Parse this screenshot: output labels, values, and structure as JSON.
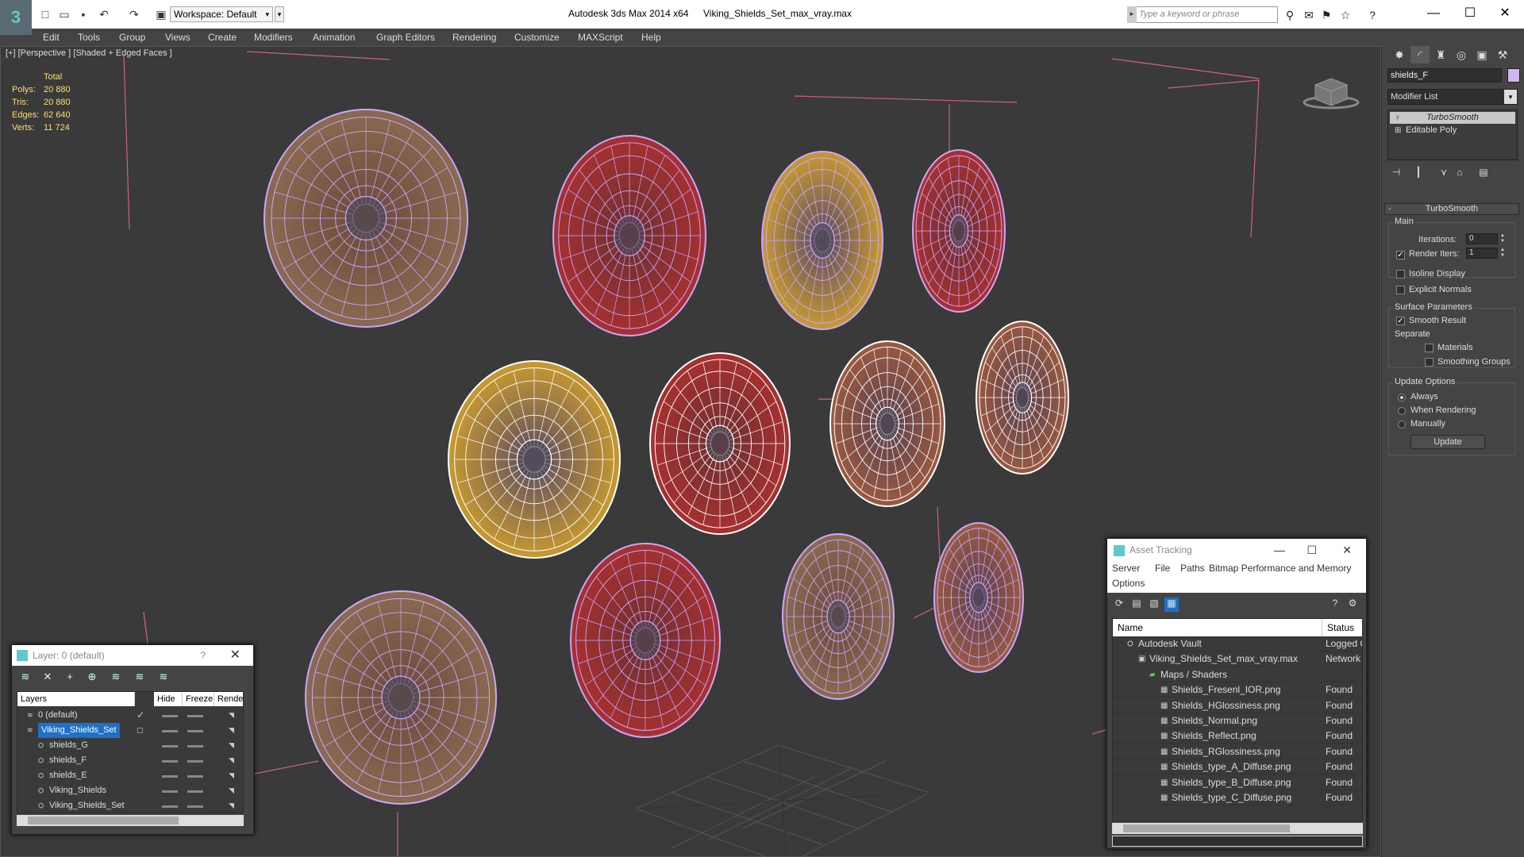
{
  "titlebar": {
    "workspace": "Workspace: Default",
    "app_title": "Autodesk 3ds Max  2014 x64",
    "file_title": "Viking_Shields_Set_max_vray.max",
    "search_placeholder": "Type a keyword or phrase"
  },
  "menu": [
    "Edit",
    "Tools",
    "Group",
    "Views",
    "Create",
    "Modifiers",
    "Animation",
    "Graph Editors",
    "Rendering",
    "Customize",
    "MAXScript",
    "Help"
  ],
  "viewport": {
    "label": "[+] [Perspective ] [Shaded + Edged Faces ]",
    "stats": {
      "header": "Total",
      "rows": [
        {
          "k": "Polys:",
          "v": "20 880"
        },
        {
          "k": "Tris:",
          "v": "20 880"
        },
        {
          "k": "Edges:",
          "v": "62 640"
        },
        {
          "k": "Verts:",
          "v": "11 724"
        }
      ]
    },
    "wire_color": "#c9a6ff",
    "selected_wire_color": "#ffffff"
  },
  "command_panel": {
    "object_name": "shields_F",
    "object_color": "#d2b4f0",
    "modifier_list": "Modifier List",
    "stack": [
      "TurboSmooth",
      "Editable Poly"
    ],
    "rollout": "TurboSmooth",
    "main_group": "Main",
    "iterations_label": "Iterations:",
    "iterations_value": "0",
    "render_iters_label": "Render Iters:",
    "render_iters_value": "1",
    "isoline_label": "Isoline Display",
    "explicit_normals_label": "Explicit Normals",
    "surface_group": "Surface Parameters",
    "smooth_result_label": "Smooth Result",
    "separate_label": "Separate",
    "materials_label": "Materials",
    "smoothing_groups_label": "Smoothing Groups",
    "update_group": "Update Options",
    "always_label": "Always",
    "when_rendering_label": "When Rendering",
    "manually_label": "Manually",
    "update_button": "Update"
  },
  "layer_dialog": {
    "title": "Layer: 0 (default)",
    "help": "?",
    "columns": [
      "Layers",
      "Hide",
      "Freeze",
      "Rende"
    ],
    "rows": [
      {
        "name": "0 (default)",
        "indent": 0,
        "selected": false
      },
      {
        "name": "Viking_Shields_Set",
        "indent": 0,
        "selected": true
      },
      {
        "name": "shields_G",
        "indent": 1,
        "selected": false
      },
      {
        "name": "shields_F",
        "indent": 1,
        "selected": false
      },
      {
        "name": "shields_E",
        "indent": 1,
        "selected": false
      },
      {
        "name": "Viking_Shields",
        "indent": 1,
        "selected": false
      },
      {
        "name": "Viking_Shields_Set",
        "indent": 1,
        "selected": false
      }
    ]
  },
  "asset_dialog": {
    "title": "Asset Tracking",
    "menu": [
      "Server",
      "File",
      "Paths",
      "Bitmap Performance and Memory",
      "Options"
    ],
    "columns": [
      "Name",
      "Status"
    ],
    "rows": [
      {
        "name": "Autodesk Vault",
        "status": "Logged O",
        "indent": 1
      },
      {
        "name": "Viking_Shields_Set_max_vray.max",
        "status": "Network P",
        "indent": 2
      },
      {
        "name": "Maps / Shaders",
        "status": "",
        "indent": 3
      },
      {
        "name": "Shields_Fresenl_IOR.png",
        "status": "Found",
        "indent": 4
      },
      {
        "name": "Shields_HGlossiness.png",
        "status": "Found",
        "indent": 4
      },
      {
        "name": "Shields_Normal.png",
        "status": "Found",
        "indent": 4
      },
      {
        "name": "Shields_Reflect.png",
        "status": "Found",
        "indent": 4
      },
      {
        "name": "Shields_RGlossiness.png",
        "status": "Found",
        "indent": 4
      },
      {
        "name": "Shields_type_A_Diffuse.png",
        "status": "Found",
        "indent": 4
      },
      {
        "name": "Shields_type_B_Diffuse.png",
        "status": "Found",
        "indent": 4
      },
      {
        "name": "Shields_type_C_Diffuse.png",
        "status": "Found",
        "indent": 4
      }
    ]
  }
}
